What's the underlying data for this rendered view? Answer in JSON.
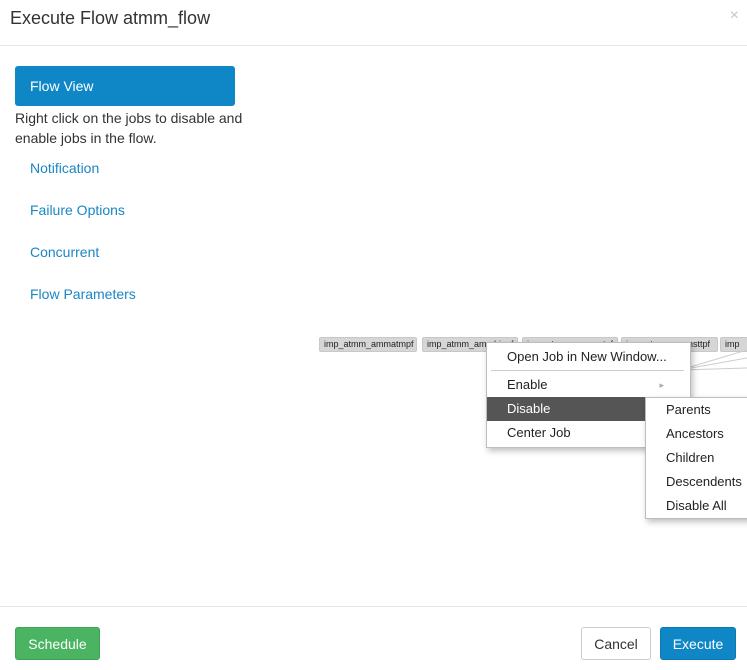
{
  "dialog": {
    "title": "Execute Flow atmm_flow",
    "close_symbol": "×"
  },
  "nav": {
    "active_label": "Flow View",
    "help_text": "Right click on the jobs to disable and enable jobs in the flow.",
    "items": [
      "Notification",
      "Failure Options",
      "Concurrent",
      "Flow Parameters"
    ]
  },
  "graph": {
    "jobs": [
      "imp_atmm_ammatmpf",
      "imp_atmm_ammbinpf",
      "imp_atmm_ammcstpf",
      "imp_atmm_ammsttpf",
      "imp"
    ]
  },
  "context_menu": {
    "open_job": "Open Job in New Window...",
    "enable": "Enable",
    "enable_arrow": "▸",
    "disable": "Disable",
    "center_job": "Center Job"
  },
  "submenu": {
    "items": [
      "Parents",
      "Ancestors",
      "Children",
      "Descendents",
      "Disable All"
    ]
  },
  "footer": {
    "schedule": "Schedule",
    "cancel": "Cancel",
    "execute": "Execute"
  }
}
